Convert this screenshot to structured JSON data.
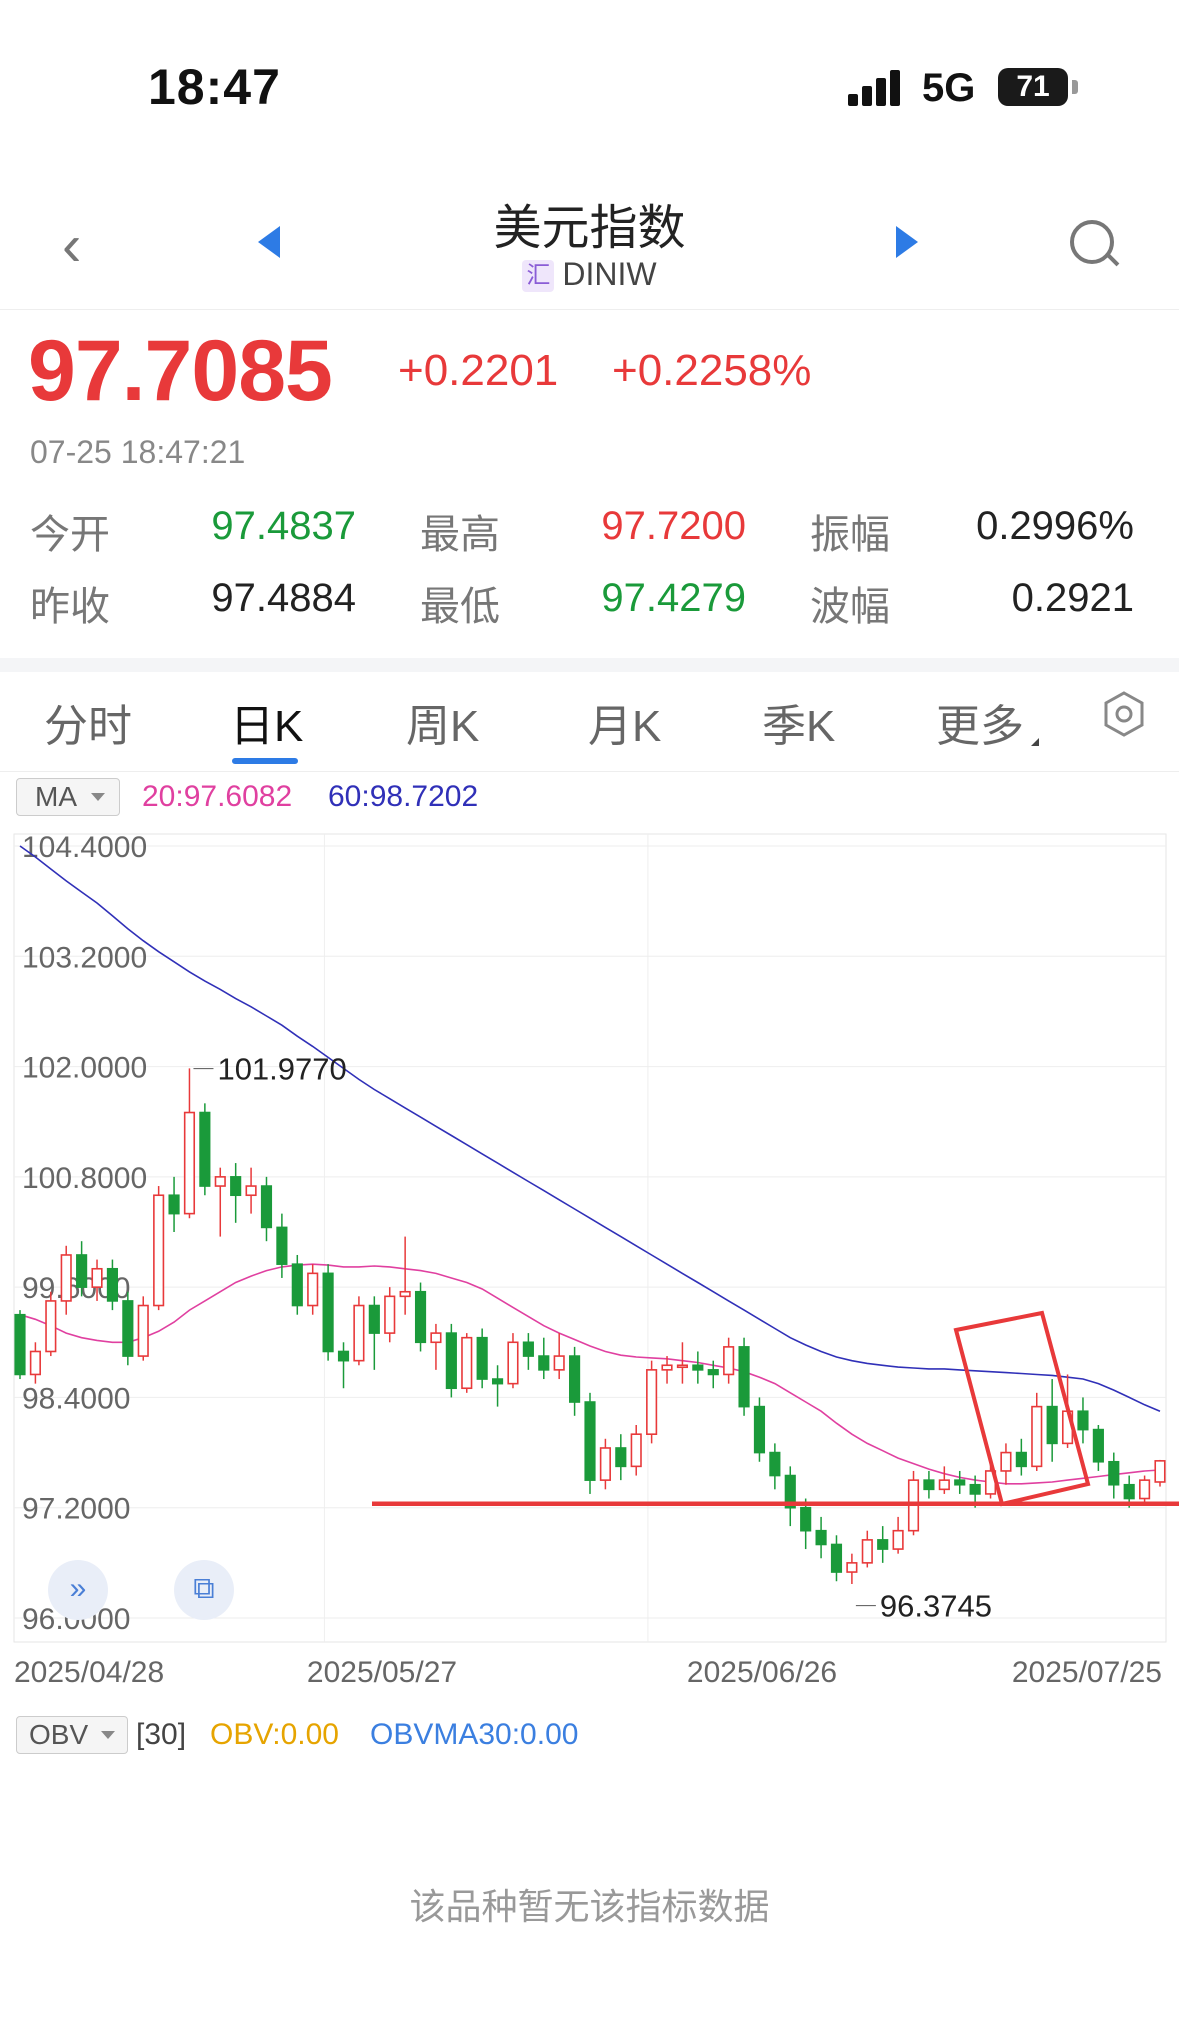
{
  "status_bar": {
    "time": "18:47",
    "network": "5G",
    "battery": "71"
  },
  "nav": {
    "title": "美元指数",
    "badge": "汇",
    "code": "DINIW"
  },
  "quote": {
    "price": "97.7085",
    "change": "+0.2201",
    "change_pct": "+0.2258%",
    "time": "07-25 18:47:21"
  },
  "stats": {
    "open_label": "今开",
    "open": "97.4837",
    "prev_close_label": "昨收",
    "prev_close": "97.4884",
    "high_label": "最高",
    "high": "97.7200",
    "low_label": "最低",
    "low": "97.4279",
    "amplitude_label": "振幅",
    "amplitude": "0.2996%",
    "wave_label": "波幅",
    "wave": "0.2921"
  },
  "tabs": [
    "分时",
    "日K",
    "周K",
    "月K",
    "季K",
    "更多"
  ],
  "active_tab": "日K",
  "legend": {
    "ma_button": "MA",
    "ma20": "20:97.6082",
    "ma60": "60:98.7202"
  },
  "colors": {
    "up": "#e8393a",
    "down": "#1a9a3a",
    "ma20": "#e040a0",
    "ma60": "#3030b8",
    "accent": "#2d7be5"
  },
  "chart_data": {
    "type": "candlestick",
    "y_ticks": [
      "104.4000",
      "103.2000",
      "102.0000",
      "100.8000",
      "99.6000",
      "98.4000",
      "97.2000",
      "96.0000"
    ],
    "ylim": [
      96.0,
      104.4
    ],
    "x_ticks": [
      "2025/04/28",
      "2025/05/27",
      "2025/06/26",
      "2025/07/25"
    ],
    "max_label": "101.9770",
    "min_label": "96.3745",
    "candles": [
      [
        99.3,
        98.65,
        99.35,
        98.6
      ],
      [
        98.65,
        98.9,
        99.0,
        98.55
      ],
      [
        98.9,
        99.45,
        99.55,
        98.85
      ],
      [
        99.45,
        99.95,
        100.05,
        99.3
      ],
      [
        99.95,
        99.6,
        100.1,
        99.5
      ],
      [
        99.6,
        99.8,
        99.9,
        99.45
      ],
      [
        99.8,
        99.45,
        99.9,
        99.35
      ],
      [
        99.45,
        98.85,
        99.55,
        98.75
      ],
      [
        98.85,
        99.4,
        99.5,
        98.8
      ],
      [
        99.4,
        100.6,
        100.7,
        99.35
      ],
      [
        100.6,
        100.4,
        100.8,
        100.2
      ],
      [
        100.4,
        101.5,
        101.98,
        100.35
      ],
      [
        101.5,
        100.7,
        101.6,
        100.6
      ],
      [
        100.7,
        100.8,
        100.9,
        100.15
      ],
      [
        100.8,
        100.6,
        100.95,
        100.3
      ],
      [
        100.6,
        100.7,
        100.9,
        100.4
      ],
      [
        100.7,
        100.25,
        100.8,
        100.1
      ],
      [
        100.25,
        99.85,
        100.4,
        99.7
      ],
      [
        99.85,
        99.4,
        99.95,
        99.3
      ],
      [
        99.4,
        99.75,
        99.85,
        99.3
      ],
      [
        99.75,
        98.9,
        99.85,
        98.8
      ],
      [
        98.9,
        98.8,
        99.0,
        98.5
      ],
      [
        98.8,
        99.4,
        99.5,
        98.75
      ],
      [
        99.4,
        99.1,
        99.5,
        98.7
      ],
      [
        99.1,
        99.5,
        99.6,
        99.0
      ],
      [
        99.5,
        99.55,
        100.15,
        99.3
      ],
      [
        99.55,
        99.0,
        99.65,
        98.9
      ],
      [
        99.0,
        99.1,
        99.2,
        98.7
      ],
      [
        99.1,
        98.5,
        99.2,
        98.4
      ],
      [
        98.5,
        99.05,
        99.1,
        98.45
      ],
      [
        99.05,
        98.6,
        99.15,
        98.5
      ],
      [
        98.6,
        98.55,
        98.75,
        98.3
      ],
      [
        98.55,
        99.0,
        99.1,
        98.5
      ],
      [
        99.0,
        98.85,
        99.1,
        98.7
      ],
      [
        98.85,
        98.7,
        99.05,
        98.6
      ],
      [
        98.7,
        98.85,
        99.1,
        98.6
      ],
      [
        98.85,
        98.35,
        98.95,
        98.2
      ],
      [
        98.35,
        97.5,
        98.45,
        97.35
      ],
      [
        97.5,
        97.85,
        97.95,
        97.4
      ],
      [
        97.85,
        97.65,
        98.0,
        97.5
      ],
      [
        97.65,
        98.0,
        98.1,
        97.55
      ],
      [
        98.0,
        98.7,
        98.8,
        97.9
      ],
      [
        98.7,
        98.75,
        98.85,
        98.55
      ],
      [
        98.75,
        98.75,
        99.0,
        98.55
      ],
      [
        98.75,
        98.7,
        98.9,
        98.55
      ],
      [
        98.7,
        98.65,
        98.8,
        98.5
      ],
      [
        98.65,
        98.95,
        99.05,
        98.55
      ],
      [
        98.95,
        98.3,
        99.05,
        98.2
      ],
      [
        98.3,
        97.8,
        98.4,
        97.7
      ],
      [
        97.8,
        97.55,
        97.9,
        97.4
      ],
      [
        97.55,
        97.2,
        97.65,
        97.0
      ],
      [
        97.2,
        96.95,
        97.3,
        96.75
      ],
      [
        96.95,
        96.8,
        97.1,
        96.65
      ],
      [
        96.8,
        96.5,
        96.9,
        96.4
      ],
      [
        96.5,
        96.6,
        96.7,
        96.37
      ],
      [
        96.6,
        96.85,
        96.95,
        96.55
      ],
      [
        96.85,
        96.75,
        97.0,
        96.6
      ],
      [
        96.75,
        96.95,
        97.1,
        96.7
      ],
      [
        96.95,
        97.5,
        97.6,
        96.9
      ],
      [
        97.5,
        97.4,
        97.6,
        97.3
      ],
      [
        97.4,
        97.5,
        97.65,
        97.35
      ],
      [
        97.5,
        97.45,
        97.6,
        97.35
      ],
      [
        97.45,
        97.35,
        97.55,
        97.2
      ],
      [
        97.35,
        97.6,
        97.7,
        97.3
      ],
      [
        97.6,
        97.8,
        97.9,
        97.45
      ],
      [
        97.8,
        97.65,
        97.95,
        97.55
      ],
      [
        97.65,
        98.3,
        98.45,
        97.6
      ],
      [
        98.3,
        97.9,
        98.6,
        97.7
      ],
      [
        97.9,
        98.25,
        98.65,
        97.85
      ],
      [
        98.25,
        98.05,
        98.4,
        97.9
      ],
      [
        98.05,
        97.7,
        98.1,
        97.6
      ],
      [
        97.7,
        97.45,
        97.8,
        97.3
      ],
      [
        97.45,
        97.3,
        97.55,
        97.2
      ],
      [
        97.3,
        97.5,
        97.55,
        97.25
      ],
      [
        97.48,
        97.71,
        97.72,
        97.43
      ]
    ],
    "ma20": [
      99.3,
      99.25,
      99.18,
      99.1,
      99.05,
      99.02,
      99.0,
      99.0,
      99.05,
      99.12,
      99.22,
      99.35,
      99.45,
      99.55,
      99.65,
      99.72,
      99.78,
      99.82,
      99.84,
      99.85,
      99.84,
      99.82,
      99.82,
      99.83,
      99.82,
      99.8,
      99.78,
      99.75,
      99.7,
      99.65,
      99.58,
      99.48,
      99.38,
      99.28,
      99.18,
      99.1,
      99.03,
      98.96,
      98.9,
      98.86,
      98.84,
      98.83,
      98.82,
      98.8,
      98.78,
      98.75,
      98.72,
      98.68,
      98.62,
      98.55,
      98.45,
      98.35,
      98.25,
      98.12,
      98.0,
      97.9,
      97.82,
      97.74,
      97.68,
      97.62,
      97.57,
      97.53,
      97.5,
      97.48,
      97.46,
      97.46,
      97.47,
      97.48,
      97.5,
      97.52,
      97.54,
      97.56,
      97.58,
      97.6,
      97.61
    ],
    "ma60": [
      104.4,
      104.28,
      104.15,
      104.02,
      103.9,
      103.78,
      103.64,
      103.5,
      103.37,
      103.25,
      103.14,
      103.03,
      102.93,
      102.84,
      102.74,
      102.65,
      102.55,
      102.45,
      102.33,
      102.22,
      102.1,
      101.98,
      101.86,
      101.75,
      101.65,
      101.55,
      101.45,
      101.35,
      101.25,
      101.15,
      101.05,
      100.95,
      100.85,
      100.75,
      100.65,
      100.55,
      100.45,
      100.35,
      100.25,
      100.15,
      100.05,
      99.95,
      99.85,
      99.75,
      99.65,
      99.55,
      99.45,
      99.35,
      99.25,
      99.15,
      99.05,
      98.97,
      98.9,
      98.84,
      98.8,
      98.77,
      98.75,
      98.73,
      98.72,
      98.71,
      98.71,
      98.7,
      98.69,
      98.68,
      98.67,
      98.66,
      98.65,
      98.64,
      98.62,
      98.6,
      98.55,
      98.48,
      98.4,
      98.32,
      98.25
    ]
  },
  "obv": {
    "button": "OBV",
    "period": "[30]",
    "obv": "OBV:0.00",
    "obvma": "OBVMA30:0.00",
    "empty_text": "该品种暂无该指标数据"
  }
}
